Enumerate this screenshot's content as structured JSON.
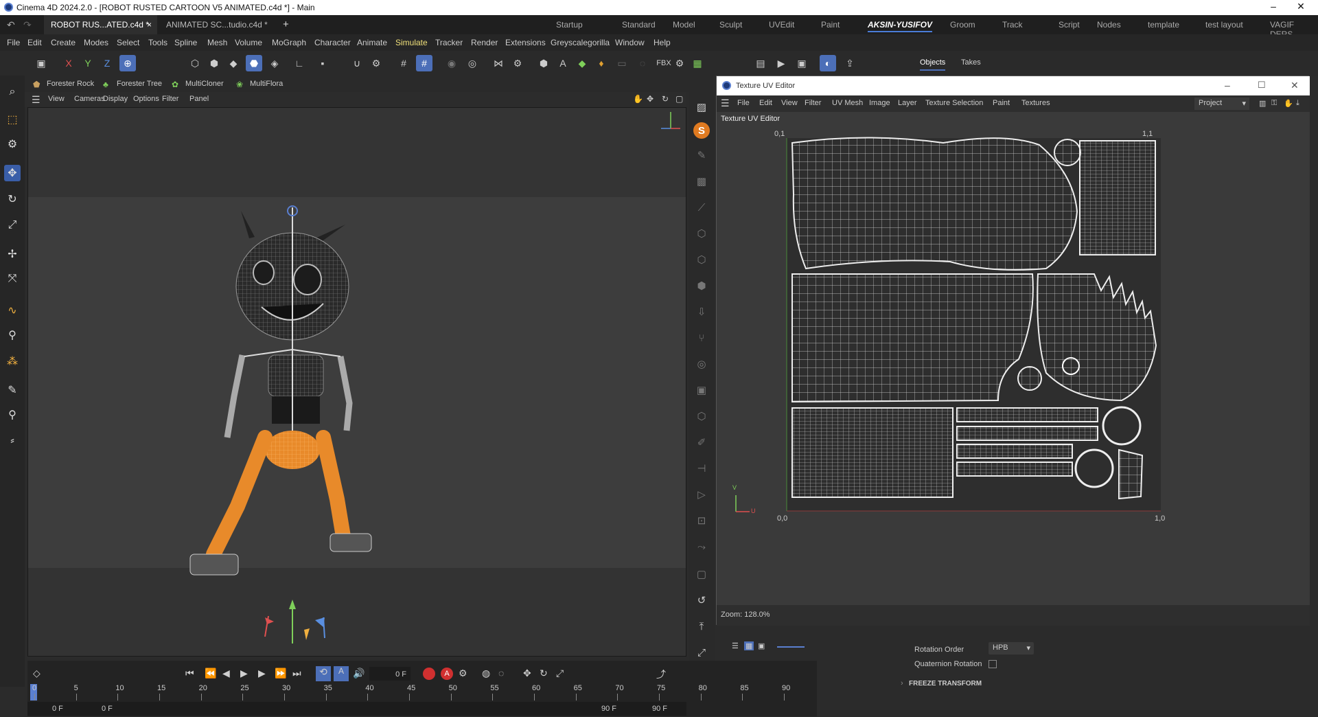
{
  "window": {
    "title": "Cinema 4D 2024.2.0 - [ROBOT RUSTED CARTOON V5 ANIMATED.c4d *] - Main"
  },
  "file_tabs": [
    {
      "label": "ROBOT RUS...ATED.c4d *"
    },
    {
      "label": "ANIMATED SC...tudio.c4d *"
    }
  ],
  "layouts": [
    "Startup",
    "Standard",
    "Model",
    "Sculpt",
    "UVEdit",
    "Paint",
    "AKSIN-YUSIFOV",
    "Groom",
    "Track",
    "Script",
    "Nodes",
    "template",
    "test layout",
    "VAGIF DERS"
  ],
  "active_layout": "AKSIN-YUSIFOV",
  "menu": [
    "File",
    "Edit",
    "Create",
    "Modes",
    "Select",
    "Tools",
    "Spline",
    "Mesh",
    "Volume",
    "MoGraph",
    "Character",
    "Animate",
    "Simulate",
    "Tracker",
    "Render",
    "Extensions",
    "Greyscalegorilla",
    "Window",
    "Help"
  ],
  "toolbar": {
    "x": "X",
    "y": "Y",
    "z": "Z",
    "fbx": "FBX"
  },
  "plugins": [
    "Forester Rock",
    "Forester Tree",
    "MultiCloner",
    "MultiFlora"
  ],
  "viewport_menu": [
    "View",
    "Cameras",
    "Display",
    "Options",
    "Filter",
    "Panel"
  ],
  "panel_tabs": [
    "Objects",
    "Takes"
  ],
  "uv_editor": {
    "title": "Texture UV Editor",
    "menu": [
      "File",
      "Edit",
      "View",
      "Filter",
      "UV Mesh",
      "Image",
      "Layer",
      "Texture Selection",
      "Paint",
      "Textures"
    ],
    "project_select": "Project",
    "label": "Texture UV Editor",
    "corner_01": "0,1",
    "corner_00": "0,0",
    "corner_10": "1,0",
    "corner_11": "1,1",
    "axis_v": "V",
    "axis_u": "U",
    "zoom": "Zoom: 128.0%"
  },
  "attributes": {
    "rotation_order_label": "Rotation Order",
    "rotation_order_value": "HPB",
    "quaternion_label": "Quaternion Rotation",
    "freeze_label": "FREEZE TRANSFORM"
  },
  "timeline": {
    "current_frame": "0 F",
    "ticks": [
      "0",
      "5",
      "10",
      "15",
      "20",
      "25",
      "30",
      "35",
      "40",
      "45",
      "50",
      "55",
      "60",
      "65",
      "70",
      "75",
      "80",
      "85",
      "90"
    ],
    "start": "0 F",
    "start2": "0 F",
    "end": "90 F",
    "end2": "90 F"
  },
  "colors": {
    "accent": "#4c6fb8",
    "bone_selected": "#f0952a",
    "timeline_marker": "#5a7fd0"
  }
}
